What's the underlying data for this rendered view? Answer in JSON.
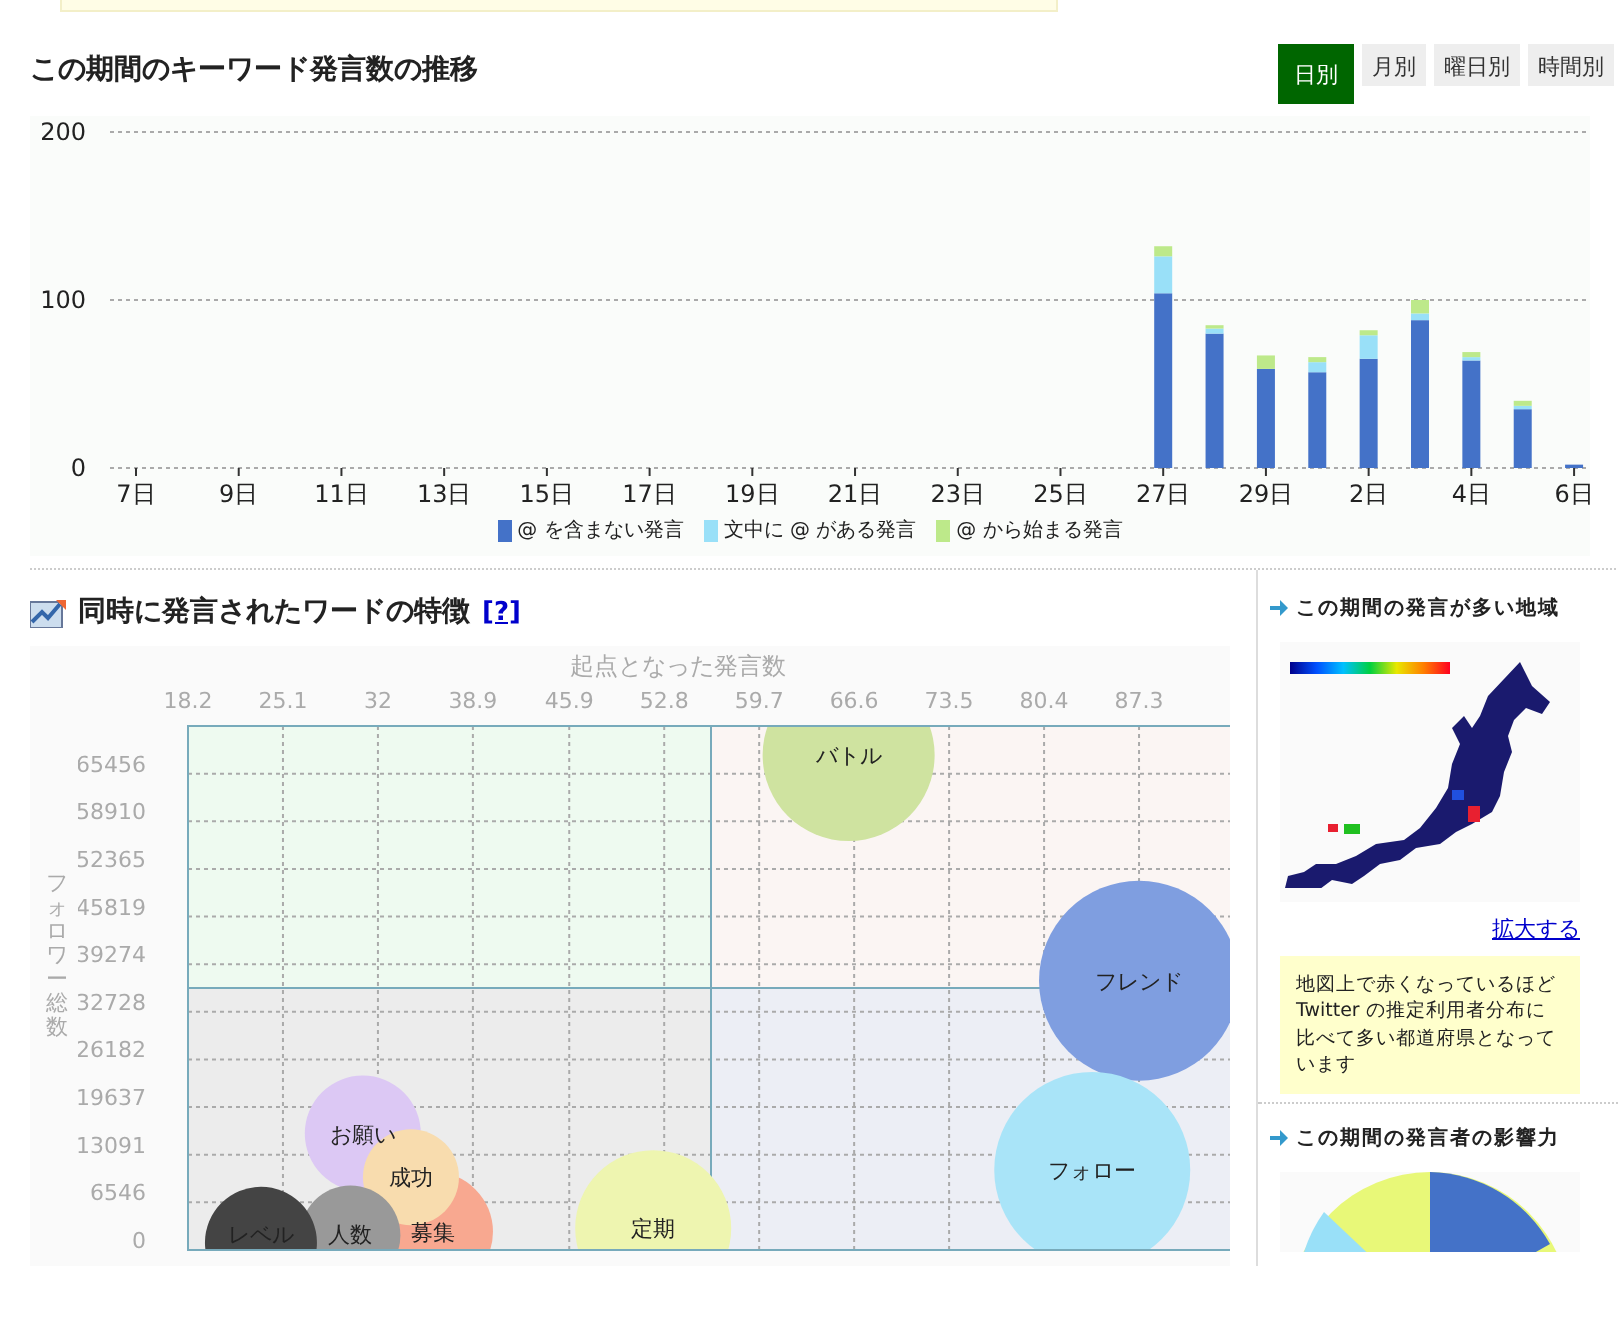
{
  "trend": {
    "title": "この期間のキーワード発言数の推移",
    "tabs": [
      {
        "label": "日別",
        "selected": true
      },
      {
        "label": "月別",
        "selected": false
      },
      {
        "label": "曜日別",
        "selected": false
      },
      {
        "label": "時間別",
        "selected": false
      }
    ],
    "chart_data": {
      "type": "bar",
      "stacked": true,
      "categories": [
        "7日",
        null,
        "9日",
        null,
        "11日",
        null,
        "13日",
        null,
        "15日",
        null,
        "17日",
        null,
        "19日",
        null,
        "21日",
        null,
        "23日",
        null,
        "25日",
        null,
        "27日",
        null,
        "29日",
        null,
        "2日",
        null,
        "4日",
        null,
        "6日"
      ],
      "ylim": [
        0,
        200
      ],
      "yticks": [
        0,
        100,
        200
      ],
      "series": [
        {
          "name": "@ を含まない発言",
          "color": "#4472c8",
          "values": [
            0,
            0,
            0,
            0,
            0,
            0,
            0,
            0,
            0,
            0,
            0,
            0,
            0,
            0,
            0,
            0,
            0,
            0,
            0,
            0,
            104,
            80,
            59,
            57,
            65,
            88,
            64,
            35,
            2
          ]
        },
        {
          "name": "文中に @ がある発言",
          "color": "#99e0f8",
          "values": [
            0,
            0,
            0,
            0,
            0,
            0,
            0,
            0,
            0,
            0,
            0,
            0,
            0,
            0,
            0,
            0,
            0,
            0,
            0,
            0,
            22,
            3,
            0,
            6,
            14,
            4,
            2,
            2,
            0
          ]
        },
        {
          "name": "@ から始まる発言",
          "color": "#bde98a",
          "values": [
            0,
            0,
            0,
            0,
            0,
            0,
            0,
            0,
            0,
            0,
            0,
            0,
            0,
            0,
            0,
            0,
            0,
            0,
            0,
            0,
            6,
            2,
            8,
            3,
            3,
            8,
            3,
            3,
            0
          ]
        }
      ]
    }
  },
  "features": {
    "title": "同時に発言されたワードの特徴",
    "help_link": "[?]",
    "chart_data": {
      "type": "scatter",
      "xlabel": "起点となった発言数",
      "ylabel": "フォロワー総数",
      "xlim": [
        18.2,
        94.2
      ],
      "ylim": [
        0,
        72000
      ],
      "grid": true,
      "ref_lines": [
        {
          "axis": "x",
          "value": 56.2
        },
        {
          "axis": "y",
          "value": 36000
        }
      ],
      "xticks": [
        18.2,
        25.1,
        32,
        38.9,
        45.9,
        52.8,
        59.7,
        66.6,
        73.5,
        80.4,
        87.3
      ],
      "yticks": [
        0,
        6546,
        13091,
        19637,
        26182,
        32728,
        39274,
        45819,
        52365,
        58910,
        65456
      ],
      "series": [
        {
          "name": "バトル",
          "color": "#cfe3a0",
          "x": [
            66.2
          ],
          "values": [
            68000
          ]
        },
        {
          "name": "フレンド",
          "color": "#7f9ee0",
          "x": [
            87.3
          ],
          "values": [
            37000
          ]
        },
        {
          "name": "フォロー",
          "color": "#a9e4f8",
          "x": [
            83.9
          ],
          "values": [
            11000
          ]
        },
        {
          "name": "お願い",
          "color": "#dcc8f4",
          "x": [
            30.9
          ],
          "values": [
            16000
          ]
        },
        {
          "name": "募集",
          "color": "#f8a890",
          "x": [
            36.0
          ],
          "values": [
            2500
          ]
        },
        {
          "name": "成功",
          "color": "#f8dcae",
          "x": [
            34.4
          ],
          "values": [
            10000
          ]
        },
        {
          "name": "定期",
          "color": "#eef5b0",
          "x": [
            52.0
          ],
          "values": [
            3000
          ]
        },
        {
          "name": "人数",
          "color": "#999999",
          "x": [
            30.0
          ],
          "values": [
            2000
          ]
        },
        {
          "name": "レベル",
          "color": "#444444",
          "x": [
            23.5
          ],
          "values": [
            1000
          ]
        }
      ]
    }
  },
  "region": {
    "title": "この期間の発言が多い地域",
    "zoom_link": "拡大する",
    "note": "地図上で赤くなっているほど Twitter の推定利用者分布に比べて多い都道府県となっています"
  },
  "influence": {
    "title": "この期間の発言者の影響力"
  }
}
